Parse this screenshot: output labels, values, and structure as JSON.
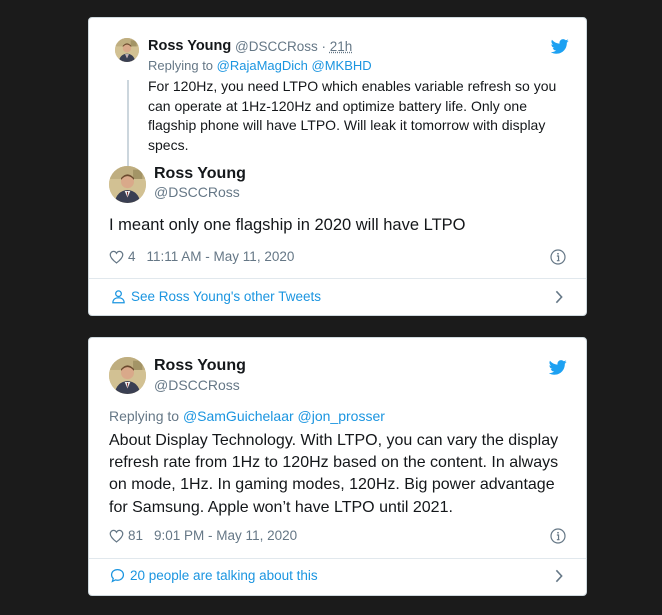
{
  "colors": {
    "background": "#1b1b1b",
    "card": "#ffffff",
    "link": "#1b95e0",
    "muted": "#657786",
    "text": "#14171a"
  },
  "embed1": {
    "quoted": {
      "author_name": "Ross Young",
      "handle": "@DSCCRoss",
      "separator": "·",
      "time": "21h",
      "replying_prefix": "Replying to",
      "replying_users": [
        "@RajaMagDich",
        "@MKBHD"
      ],
      "text_lines": [
        "For 120Hz, you need LTPO which enables variable refresh so you",
        "can operate at 1Hz-120Hz and optimize battery life. Only one",
        "flagship phone will have LTPO. Will leak it tomorrow with display",
        "specs."
      ]
    },
    "author_name": "Ross Young",
    "handle": "@DSCCRoss",
    "text": "I meant only one flagship in 2020 will have LTPO",
    "likes": "4",
    "timestamp": "11:11 AM - May 11, 2020",
    "footer_link": "See Ross Young's other Tweets",
    "icons": [
      "twitter-bird-icon",
      "heart-icon",
      "info-icon",
      "person-icon",
      "chevron-right-icon"
    ]
  },
  "embed2": {
    "author_name": "Ross Young",
    "handle": "@DSCCRoss",
    "replying_prefix": "Replying to",
    "replying_users": [
      "@SamGuichelaar",
      "@jon_prosser"
    ],
    "text_lines": [
      "About Display Technology. With LTPO, you can vary the display",
      "refresh rate from 1Hz to 120Hz based on the content. In always",
      "on mode, 1Hz. In gaming modes, 120Hz. Big power advantage",
      "for Samsung. Apple won’t have LTPO until 2021."
    ],
    "likes": "81",
    "timestamp": "9:01 PM - May 11, 2020",
    "footer_link": "20 people are talking about this",
    "icons": [
      "twitter-bird-icon",
      "heart-icon",
      "info-icon",
      "speech-bubble-icon",
      "chevron-right-icon"
    ]
  }
}
